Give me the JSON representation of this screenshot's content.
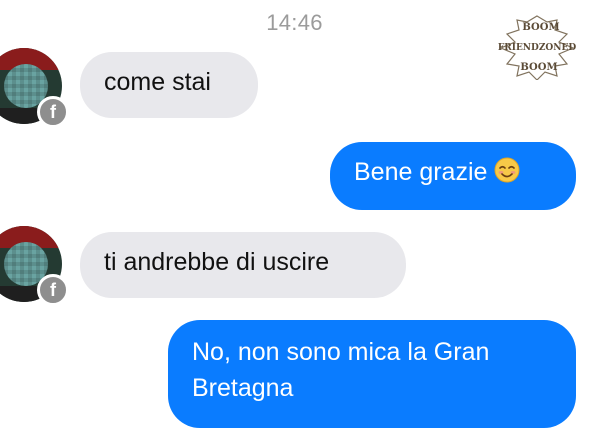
{
  "chat": {
    "timestamp": "14:46",
    "messages": [
      {
        "side": "incoming",
        "text": "come stai"
      },
      {
        "side": "outgoing",
        "text": "Bene grazie",
        "emoji": "smiling-face-emoji"
      },
      {
        "side": "incoming",
        "text": "ti andrebbe di uscire"
      },
      {
        "side": "outgoing",
        "text": "No, non sono mica la Gran Bretagna"
      }
    ]
  },
  "contact": {
    "badge_glyph": "f",
    "avatar_icon": "profile-avatar"
  },
  "watermark": {
    "line1": "BOOM",
    "line2": "FRIENDZONED",
    "line3": "BOOM"
  },
  "colors": {
    "outgoing_bubble": "#0a7cff",
    "incoming_bubble": "#e8e8ec",
    "timestamp_text": "#9b9b9b",
    "badge": "#8e8e8e"
  }
}
